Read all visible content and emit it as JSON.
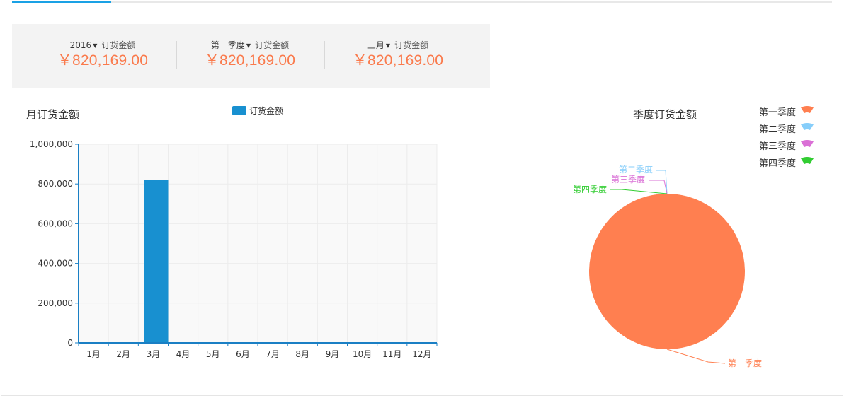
{
  "summary": [
    {
      "period": "2016",
      "metric": "订货金额",
      "value": "￥820,169.00"
    },
    {
      "period": "第一季度",
      "metric": "订货金额",
      "value": "￥820,169.00"
    },
    {
      "period": "三月",
      "metric": "订货金额",
      "value": "￥820,169.00"
    }
  ],
  "chart_data": [
    {
      "type": "bar",
      "title": "月订货金额",
      "categories": [
        "1月",
        "2月",
        "3月",
        "4月",
        "5月",
        "6月",
        "7月",
        "8月",
        "9月",
        "10月",
        "11月",
        "12月"
      ],
      "series": [
        {
          "name": "订货金额",
          "values": [
            0,
            0,
            820169,
            0,
            0,
            0,
            0,
            0,
            0,
            0,
            0,
            0
          ],
          "color": "#1890d0"
        }
      ],
      "ylim": [
        0,
        1000000
      ],
      "yticks": [
        "0",
        "200,000",
        "400,000",
        "600,000",
        "800,000",
        "1,000,000"
      ],
      "grid": true,
      "legend": "top"
    },
    {
      "type": "pie",
      "title": "季度订货金额",
      "labels": [
        "第一季度",
        "第二季度",
        "第三季度",
        "第四季度"
      ],
      "values": [
        820169,
        0,
        0,
        0
      ],
      "colors": [
        "#ff7f50",
        "#87cefa",
        "#da70d6",
        "#32cd32"
      ],
      "legend": "top-right"
    }
  ]
}
